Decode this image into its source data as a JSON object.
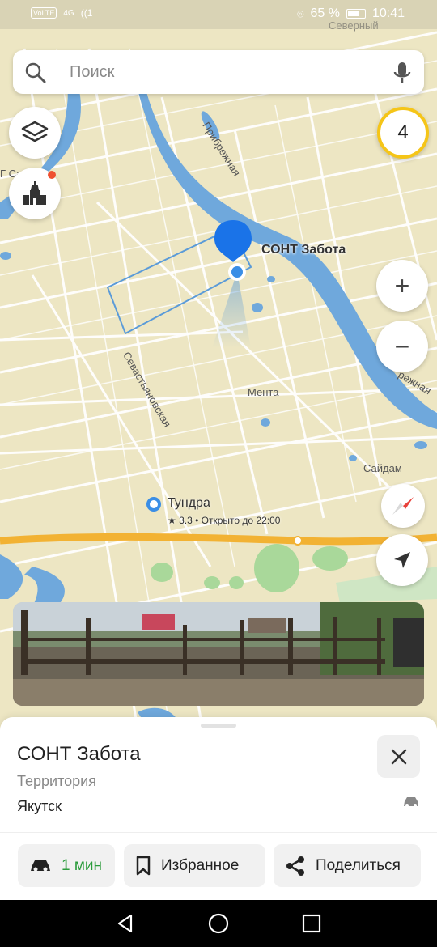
{
  "status_bar": {
    "time": "10:41",
    "battery": "65 %",
    "network": "VoLTE",
    "signal": "4G",
    "wifi": "1"
  },
  "search": {
    "placeholder": "Поиск"
  },
  "map": {
    "labels": {
      "north_district": "Северный",
      "street_pribrezhnaya": "Прибрежная",
      "street_sevastyanovskaya": "Севастьяновская",
      "district_menta": "Мента",
      "district_saydam": "Сайдам",
      "street_edge": "режная",
      "edge_left": "Г Са"
    },
    "selected_place": "СОНТ Забота",
    "poi": {
      "name": "Тундра",
      "rating_hours": "★ 3.3 • Открыто до 22:00"
    },
    "layer_count_badge": "4",
    "zoom_in": "+",
    "zoom_out": "−"
  },
  "card": {
    "title": "СОНТ Забота",
    "type": "Территория",
    "city": "Якутск"
  },
  "actions": {
    "route_label": "1 мин",
    "favorite_label": "Избранное",
    "share_label": "Поделиться"
  },
  "colors": {
    "map_bg": "#ede6c3",
    "water": "#6fa8dc",
    "highway": "#f2b233",
    "pin": "#1a73e8",
    "route_green": "#2a9b3a"
  }
}
